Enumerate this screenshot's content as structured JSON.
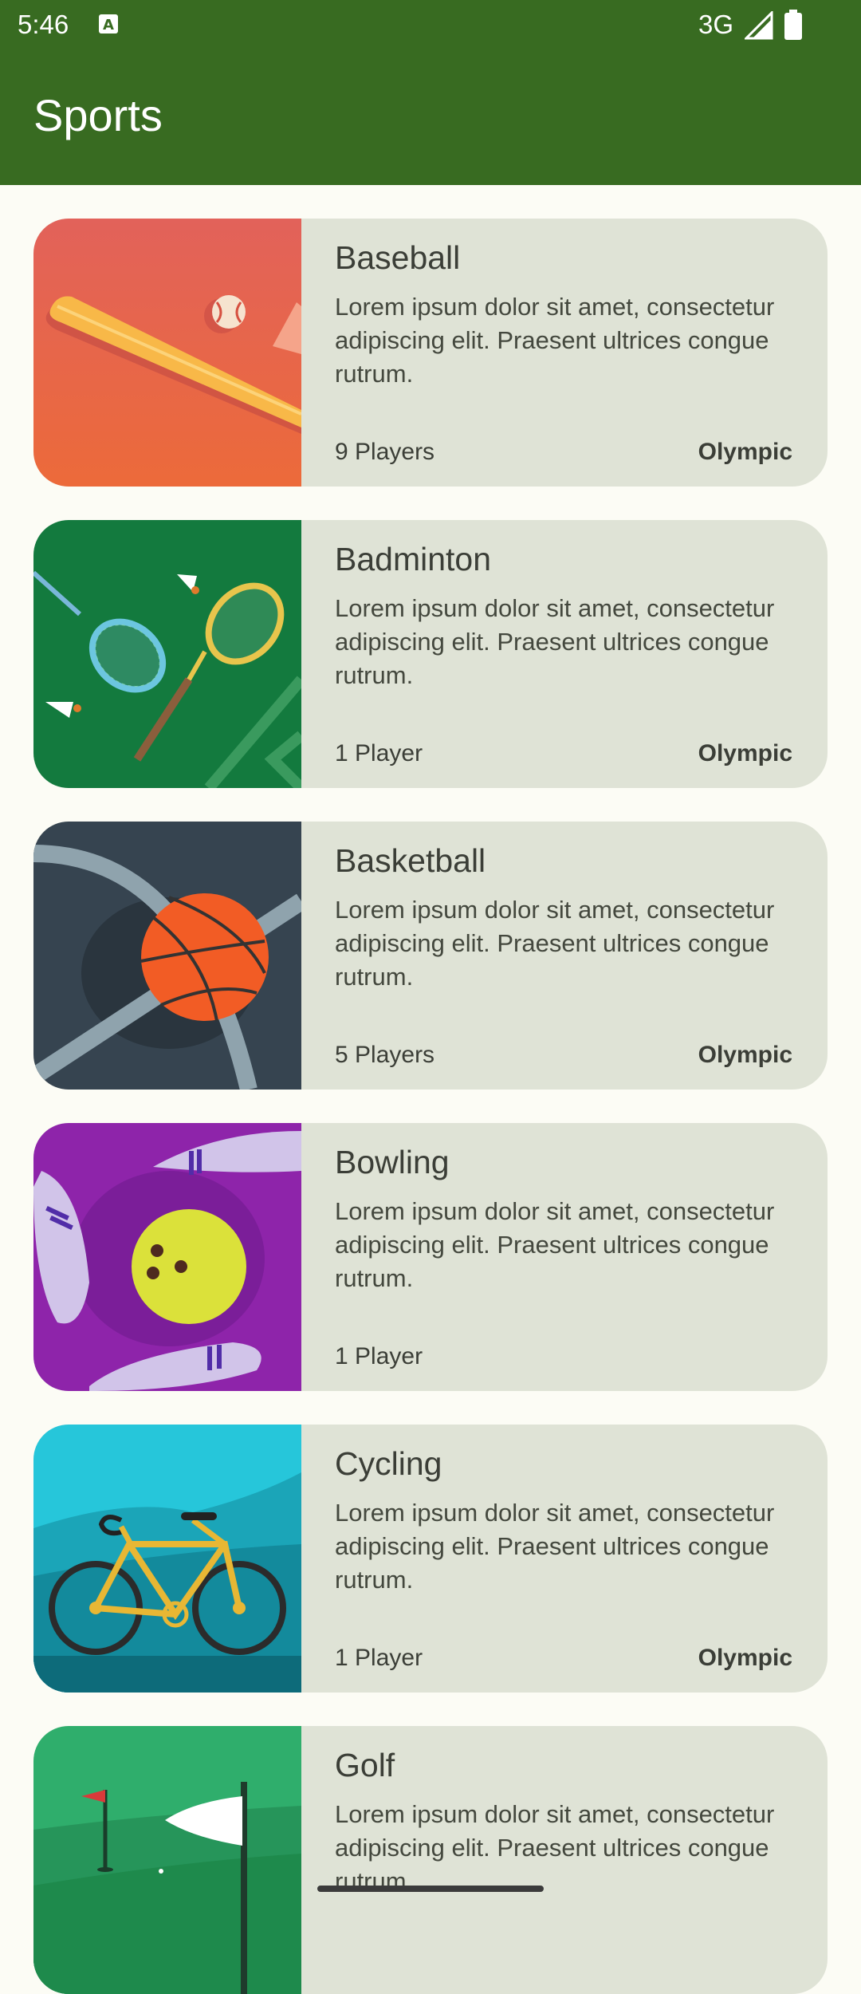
{
  "status_bar": {
    "time": "5:46",
    "network": "3G"
  },
  "app_bar": {
    "title": "Sports"
  },
  "sports": [
    {
      "name": "Baseball",
      "description": "Lorem ipsum dolor sit amet, consectetur adipiscing elit. Praesent ultrices congue rutrum.",
      "players": "9 Players",
      "olympic": "Olympic",
      "image_icon": "baseball-image"
    },
    {
      "name": "Badminton",
      "description": "Lorem ipsum dolor sit amet, consectetur adipiscing elit. Praesent ultrices congue rutrum.",
      "players": "1 Player",
      "olympic": "Olympic",
      "image_icon": "badminton-image"
    },
    {
      "name": "Basketball",
      "description": "Lorem ipsum dolor sit amet, consectetur adipiscing elit. Praesent ultrices congue rutrum.",
      "players": "5 Players",
      "olympic": "Olympic",
      "image_icon": "basketball-image"
    },
    {
      "name": "Bowling",
      "description": "Lorem ipsum dolor sit amet, consectetur adipiscing elit. Praesent ultrices congue rutrum.",
      "players": "1 Player",
      "olympic": "",
      "image_icon": "bowling-image"
    },
    {
      "name": "Cycling",
      "description": "Lorem ipsum dolor sit amet, consectetur adipiscing elit. Praesent ultrices congue rutrum.",
      "players": "1 Player",
      "olympic": "Olympic",
      "image_icon": "cycling-image"
    },
    {
      "name": "Golf",
      "description": "Lorem ipsum dolor sit amet, consectetur adipiscing elit. Praesent ultrices congue rutrum.",
      "players": "",
      "olympic": "",
      "image_icon": "golf-image"
    }
  ],
  "colors": {
    "primary": "#386b21",
    "card": "#dfe3d6",
    "background": "#fcfcf5"
  }
}
